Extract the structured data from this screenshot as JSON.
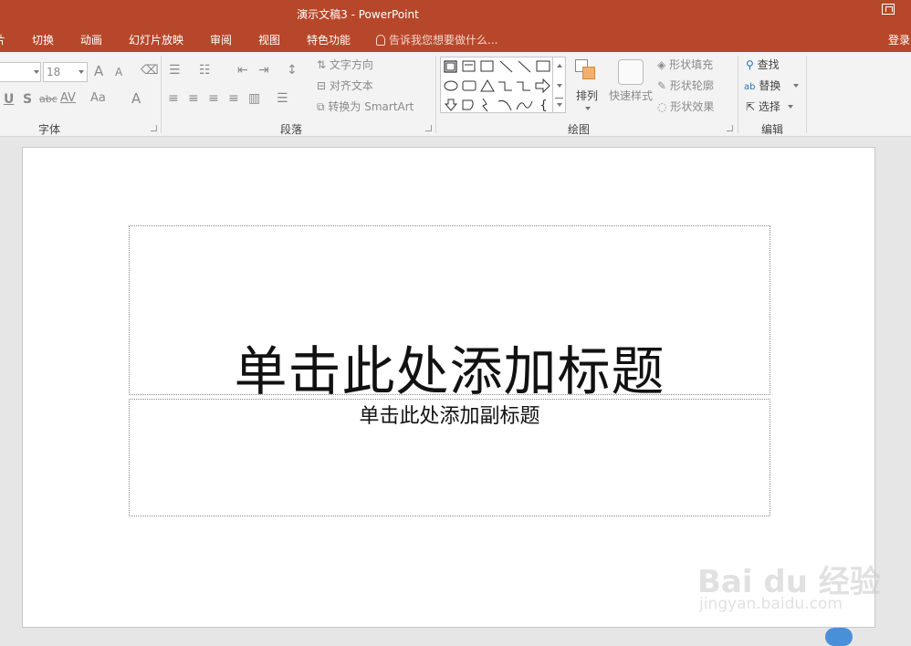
{
  "window": {
    "title": "演示文稿3 - PowerPoint"
  },
  "tabs": [
    "切换",
    "动画",
    "幻灯片放映",
    "审阅",
    "视图",
    "特色功能"
  ],
  "tab_partial": "片",
  "tell_me": "告诉我您想要做什么...",
  "login": "登录",
  "font_group": {
    "label": "字体",
    "font_size": "18",
    "buttons": [
      "A",
      "A",
      "U",
      "S",
      "abc",
      "AV",
      "Aa",
      "A"
    ]
  },
  "paragraph_group": {
    "label": "段落",
    "text_direction": "文字方向",
    "align_text": "对齐文本",
    "convert_smartart": "转换为 SmartArt"
  },
  "drawing_group": {
    "label": "绘图",
    "arrange": "排列",
    "quick_styles": "快速样式",
    "shape_fill": "形状填充",
    "shape_outline": "形状轮廓",
    "shape_effects": "形状效果"
  },
  "editing_group": {
    "label": "编辑",
    "find": "查找",
    "replace": "替换",
    "select": "选择"
  },
  "slide": {
    "title_placeholder": "单击此处添加标题",
    "subtitle_placeholder": "单击此处添加副标题"
  },
  "watermark": {
    "brand": "Bai du 经验",
    "url": "jingyan.baidu.com"
  },
  "colors": {
    "accent": "#b7472a",
    "ribbon": "#f3f3f3",
    "canvas": "#e6e6e6"
  }
}
